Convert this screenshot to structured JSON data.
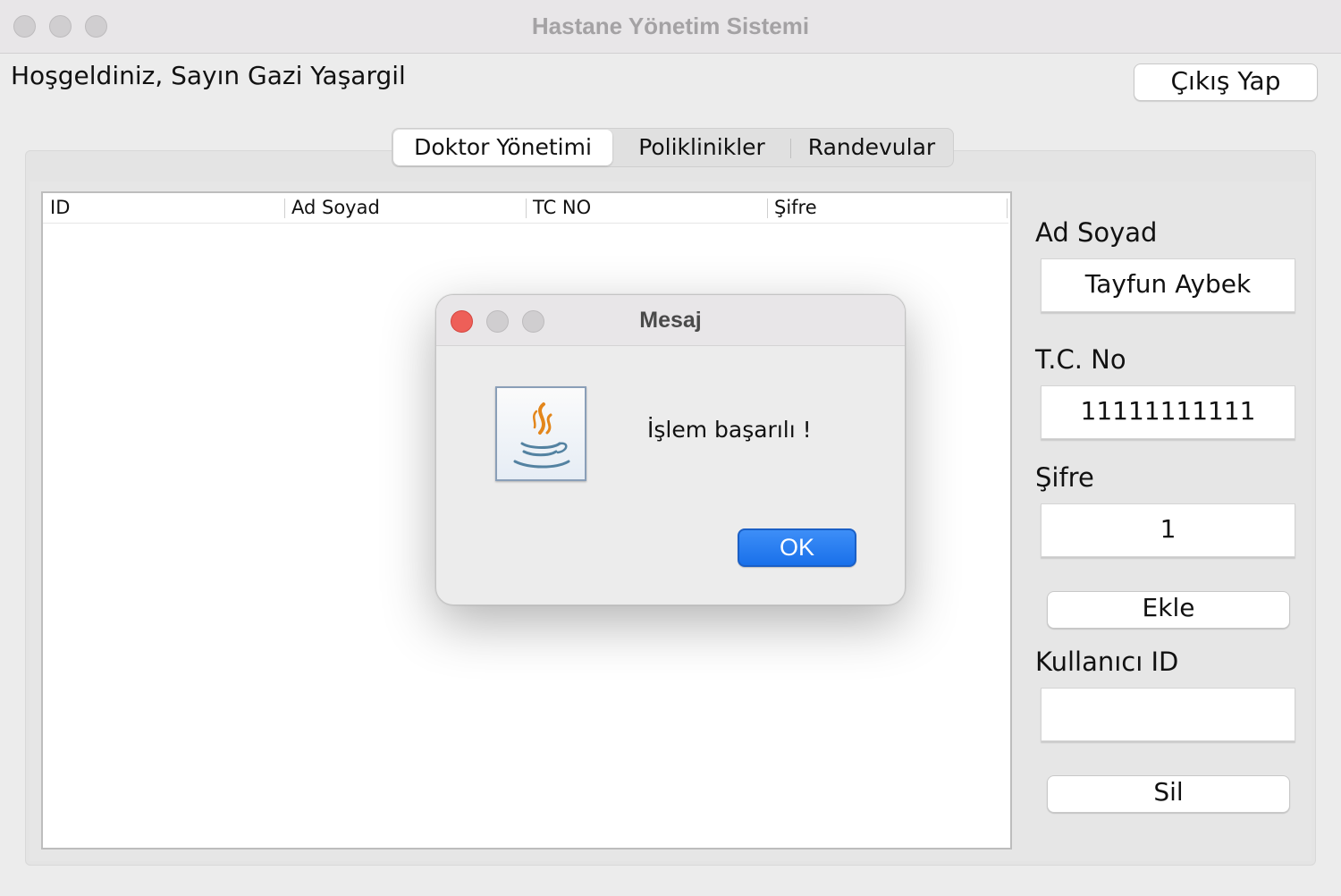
{
  "window": {
    "title": "Hastane Yönetim Sistemi"
  },
  "header": {
    "welcome_text": "Hoşgeldiniz, Sayın Gazi Yaşargil",
    "logout_label": "Çıkış Yap"
  },
  "tabs": [
    {
      "label": "Doktor Yönetimi",
      "active": true
    },
    {
      "label": "Poliklinikler",
      "active": false
    },
    {
      "label": "Randevular",
      "active": false
    }
  ],
  "table": {
    "columns": [
      "ID",
      "Ad Soyad",
      "TC NO",
      "Şifre"
    ],
    "rows": []
  },
  "form": {
    "name_label": "Ad Soyad",
    "name_value": "Tayfun Aybek",
    "tc_label": "T.C. No",
    "tc_value": "11111111111",
    "password_label": "Şifre",
    "password_value": "1",
    "add_label": "Ekle",
    "userid_label": "Kullanıcı ID",
    "userid_value": "",
    "delete_label": "Sil"
  },
  "dialog": {
    "title": "Mesaj",
    "message": "İşlem başarılı !",
    "ok_label": "OK",
    "icon": "java-icon"
  },
  "colors": {
    "accent": "#1970ea",
    "close_red": "#ee5f58",
    "java_orange": "#e3861b",
    "java_blue": "#5382a1"
  }
}
